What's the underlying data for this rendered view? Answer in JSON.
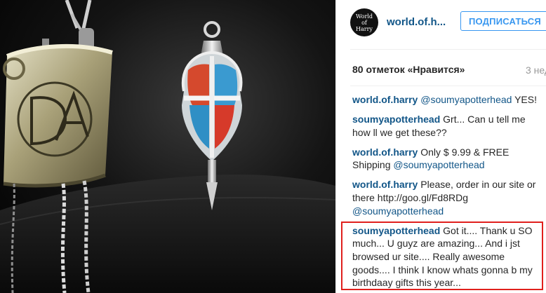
{
  "post": {
    "username": "world.of.h...",
    "avatar_text": [
      "World",
      "of",
      "Harry"
    ],
    "follow_label": "ПОДПИСАТЬСЯ",
    "likes": "80 отметок «Нравится»",
    "time": "3 нед"
  },
  "comments": [
    {
      "author": "world.of.harry",
      "parts": [
        {
          "t": "mention",
          "v": "@soumyapotterhead"
        },
        {
          "t": "text",
          "v": " YES!"
        }
      ]
    },
    {
      "author": "soumyapotterhead",
      "parts": [
        {
          "t": "text",
          "v": " Grt... Can u tell me how ll we get these??"
        }
      ]
    },
    {
      "author": "world.of.harry",
      "parts": [
        {
          "t": "text",
          "v": " Only $ 9.99 & FREE Shipping "
        },
        {
          "t": "mention",
          "v": "@soumyapotterhead"
        }
      ]
    },
    {
      "author": "world.of.harry",
      "parts": [
        {
          "t": "text",
          "v": " Please, order in our site or there http://goo.gl/Fd8RDg "
        },
        {
          "t": "mention",
          "v": "@soumyapotterhead"
        }
      ]
    },
    {
      "author": "soumyapotterhead",
      "parts": [
        {
          "t": "text",
          "v": " Got it.... Thank u SO much... U guyz are amazing... And i jst browsed ur site.... Really awesome goods.... I think I know whats gonna b my birthdaay gifts this year..."
        }
      ]
    }
  ],
  "colors": {
    "link": "#125688",
    "follow": "#3897f0",
    "highlight": "#e0201d"
  },
  "icons": {
    "pendant_left": "scroll-pendant-DA",
    "pendant_right": "winged-key-pendant"
  }
}
